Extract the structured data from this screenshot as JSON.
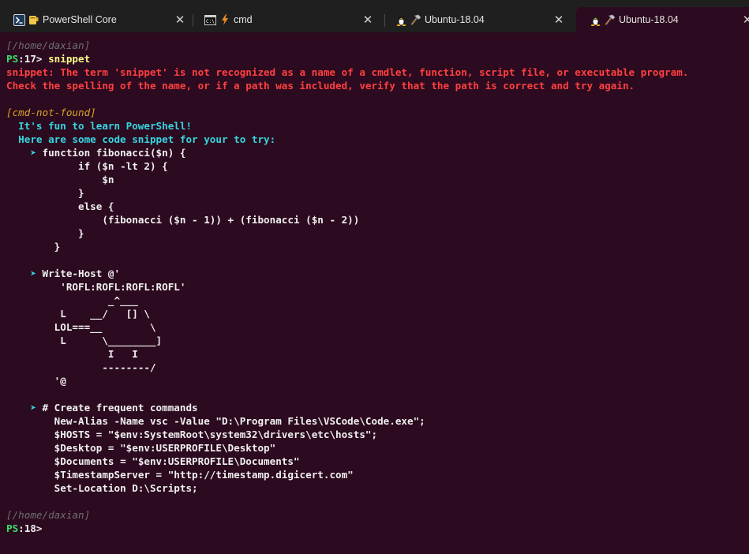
{
  "tabs": [
    {
      "label": "PowerShell Core",
      "icon": "powershell-icon",
      "active": false
    },
    {
      "label": "cmd",
      "icon": "cmd-icon",
      "active": false
    },
    {
      "label": "Ubuntu-18.04",
      "icon": "linux-icon",
      "active": false
    },
    {
      "label": "Ubuntu-18.04",
      "icon": "linux-icon",
      "active": true
    }
  ],
  "colors": {
    "background": "#2c0a1f",
    "tabbar": "#1f1f1f",
    "prompt_ps": "#36e06a",
    "error": "#ff4040",
    "tip": "#35d7e2",
    "path": "#6e6f74",
    "cmd_not_found": "#d6a22a"
  },
  "terminal": {
    "path1": "[/home/daxian]",
    "prompt1_ps": "PS",
    "prompt1_rest": ":17> ",
    "prompt1_cmd": "snippet",
    "error_line1": "snippet: The term 'snippet' is not recognized as a name of a cmdlet, function, script file, or executable program.",
    "error_line2": "Check the spelling of the name, or if a path was included, verify that the path is correct and try again.",
    "cnf_tag": "[cmd-not-found]",
    "tip1": "  It's fun to learn PowerShell!",
    "tip2": "  Here are some code snippet for your to try:",
    "arrow": "    ➤ ",
    "snippet1": [
      "function fibonacci($n) {",
      "      if ($n -lt 2) {",
      "          $n",
      "      }",
      "      else {",
      "          (fibonacci ($n - 1)) + (fibonacci ($n - 2))",
      "      }",
      "  }"
    ],
    "snippet2": [
      "Write-Host @'",
      "   'ROFL:ROFL:ROFL:ROFL'",
      "           _^___",
      "   L    __/   [] \\",
      "  LOL===__        \\",
      "   L      \\________]",
      "           I   I",
      "          --------/",
      "  '@"
    ],
    "snippet3": [
      "# Create frequent commands",
      "  New-Alias -Name vsc -Value \"D:\\Program Files\\VSCode\\Code.exe\";",
      "  $HOSTS = \"$env:SystemRoot\\system32\\drivers\\etc\\hosts\";",
      "  $Desktop = \"$env:USERPROFILE\\Desktop\"",
      "  $Documents = \"$env:USERPROFILE\\Documents\"",
      "  $TimestampServer = \"http://timestamp.digicert.com\"",
      "  Set-Location D:\\Scripts;"
    ],
    "path2": "[/home/daxian]",
    "prompt2_ps": "PS",
    "prompt2_rest": ":18>"
  }
}
